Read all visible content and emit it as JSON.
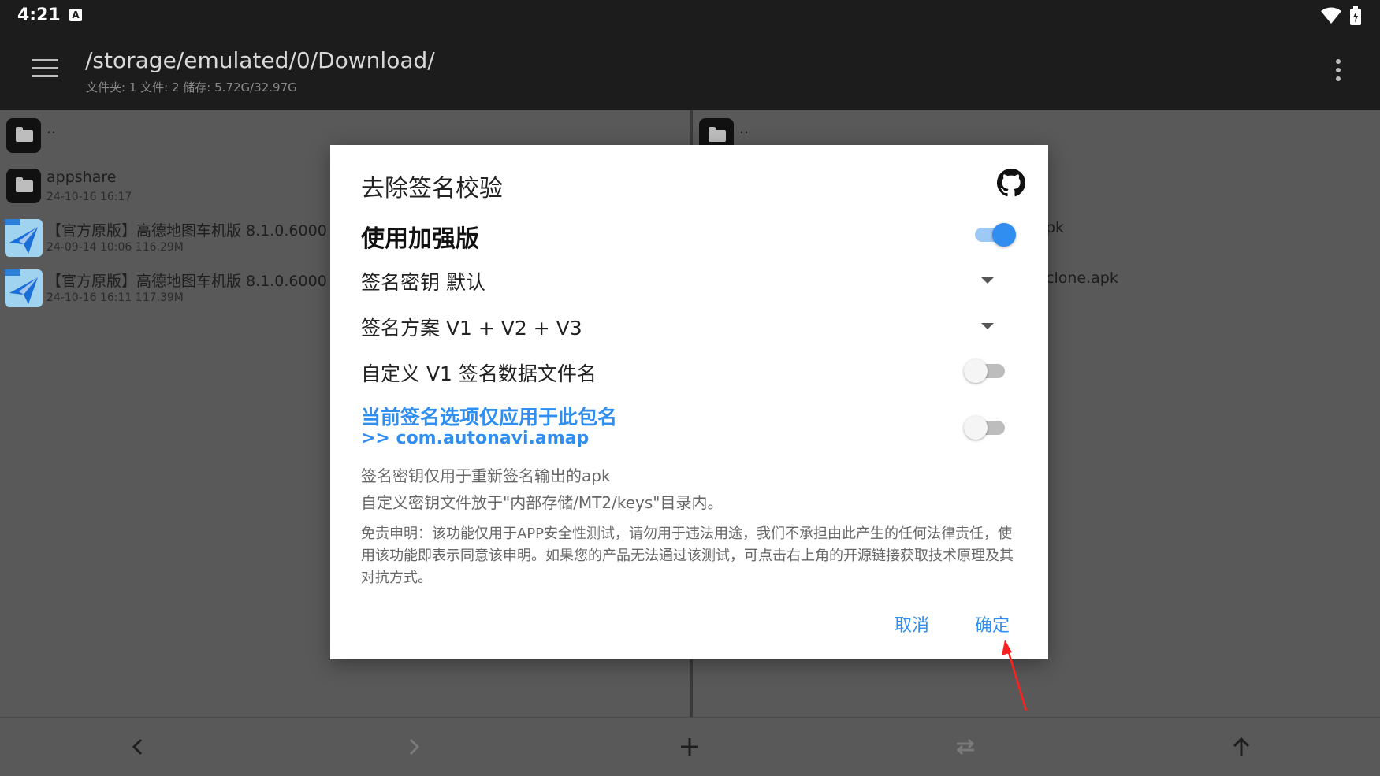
{
  "status": {
    "time": "4:21",
    "input_badge": "A"
  },
  "appbar": {
    "path": "/storage/emulated/0/Download/",
    "summary": "文件夹: 1  文件: 2  储存: 5.72G/32.97G"
  },
  "left_pane": {
    "items": [
      {
        "name": "..",
        "meta": "",
        "kind": "folder"
      },
      {
        "name": "appshare",
        "meta": "24-10-16 16:17",
        "kind": "folder"
      },
      {
        "name": "【官方原版】高德地图车机版 8.1.0.6000",
        "meta": "24-09-14 10:06  116.29M",
        "kind": "apk"
      },
      {
        "name": "【官方原版】高德地图车机版 8.1.0.6000",
        "meta": "24-10-16 16:11  117.39M",
        "kind": "apk"
      }
    ]
  },
  "right_pane": {
    "items": [
      {
        "name": "..",
        "kind": "folder"
      },
      {
        "name": "pk",
        "kind": "partial"
      },
      {
        "name": "clone.apk",
        "kind": "partial"
      }
    ]
  },
  "dialog": {
    "title": "去除签名校验",
    "enhanced_label": "使用加强版",
    "enhanced_on": true,
    "key_label": "签名密钥  默认",
    "scheme_label": "签名方案  V1 + V2 + V3",
    "custom_v1_label": "自定义 V1 签名数据文件名",
    "custom_v1_on": false,
    "package_only_line1": "当前签名选项仅应用于此包名",
    "package_only_line2": ">> com.autonavi.amap",
    "package_only_on": false,
    "note_1": "签名密钥仅用于重新签名输出的apk",
    "note_2": "自定义密钥文件放于\"内部存储/MT2/keys\"目录内。",
    "disclaimer": "免责申明：该功能仅用于APP安全性测试，请勿用于违法用途，我们不承担由此产生的任何法律责任，使用该功能即表示同意该申明。如果您的产品无法通过该测试，可点击右上角的开源链接获取技术原理及其对抗方式。",
    "cancel_label": "取消",
    "confirm_label": "确定"
  },
  "colors": {
    "accent": "#2f8ef0",
    "annotation_arrow": "#ff2020"
  }
}
